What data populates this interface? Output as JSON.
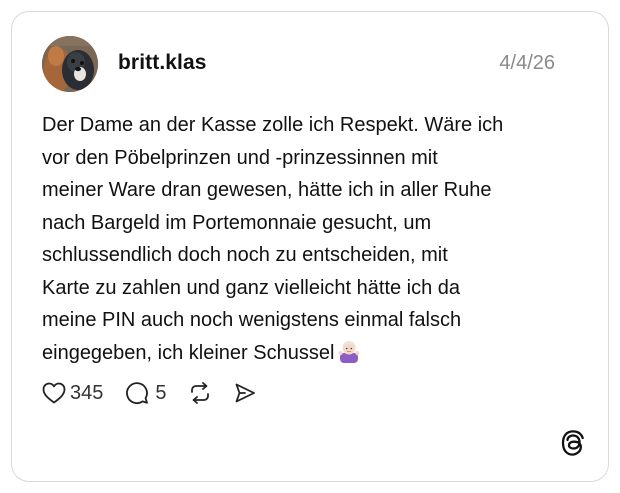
{
  "post": {
    "username": "britt.klas",
    "date": "4/4/26",
    "text": "Der Dame an der Kasse zolle ich Respekt. Wäre ich\nvor den Pöbelprinzen und -prinzessinnen mit\nmeiner Ware dran gewesen, hätte ich in aller Ruhe\nnach Bargeld im Portemonnaie gesucht, um\nschlussendlich doch noch zu entscheiden, mit\nKarte zu zahlen und ganz vielleicht hätte ich da\nmeine PIN auch noch wenigstens einmal falsch\neingegeben, ich kleiner Schussel",
    "emoji": "person-shrugging-emoji"
  },
  "actions": {
    "likes": "345",
    "replies": "5",
    "like_icon": "heart-icon",
    "reply_icon": "speech-bubble-icon",
    "repost_icon": "repost-icon",
    "share_icon": "send-icon"
  },
  "branding": {
    "logo_icon": "threads-logo-icon"
  },
  "colors": {
    "text": "#111111",
    "muted": "#8a8a8a",
    "border": "#d9d9d9"
  }
}
